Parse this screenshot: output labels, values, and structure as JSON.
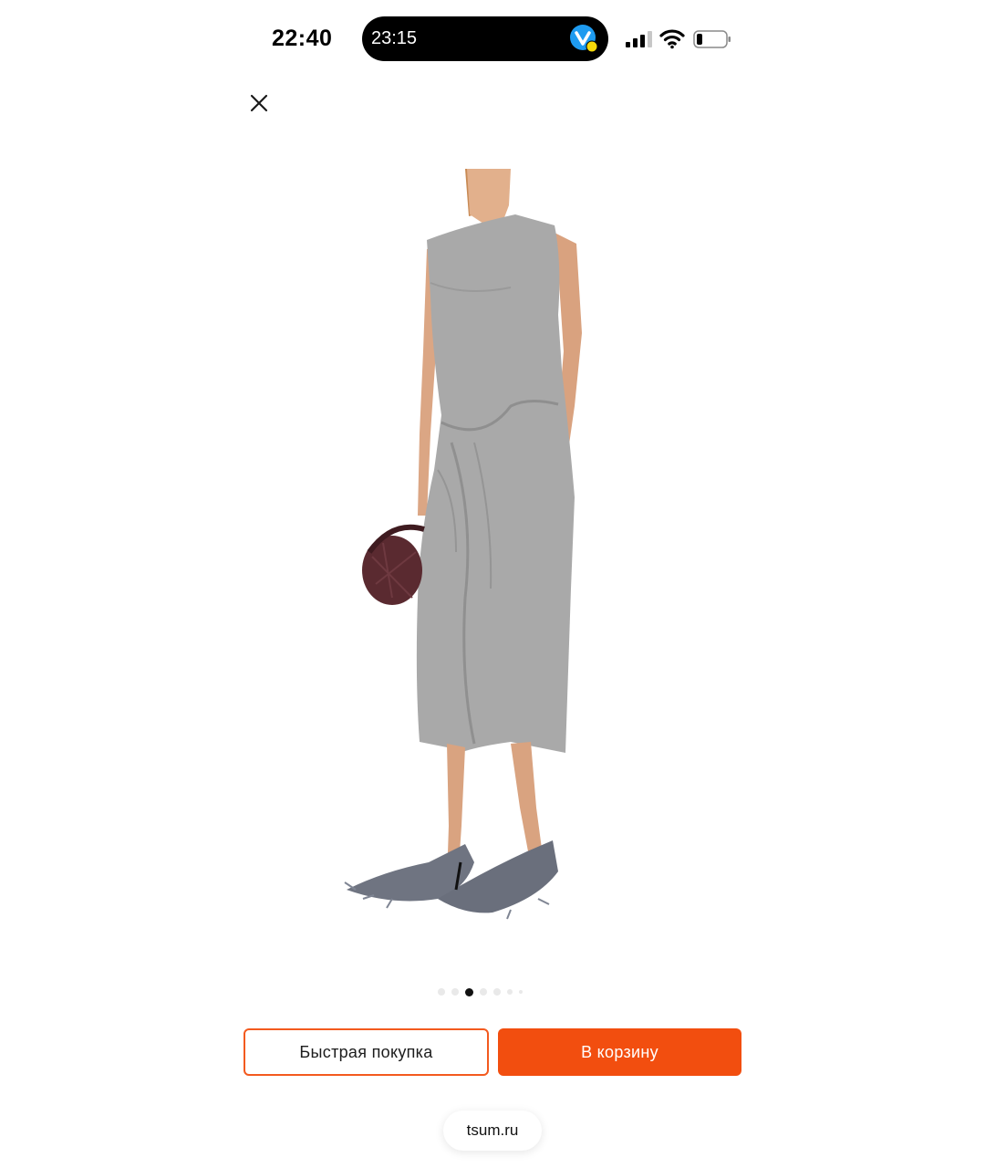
{
  "status_bar": {
    "time": "22:40",
    "island_time": "23:15",
    "app_icon": "vk-app-icon",
    "signal_icon": "cellular-signal-icon",
    "wifi_icon": "wifi-icon",
    "battery_icon": "battery-low-icon"
  },
  "header": {
    "close_icon": "close-icon"
  },
  "gallery": {
    "image_subject": "grey draped midi dress",
    "active_index": 3,
    "total": 7
  },
  "actions": {
    "quick_buy_label": "Быстрая покупка",
    "add_to_cart_label": "В корзину"
  },
  "browser": {
    "url": "tsum.ru"
  },
  "colors": {
    "accent": "#f24e0f",
    "quick_border": "#f35a1f",
    "dress": "#a9a9a9"
  }
}
